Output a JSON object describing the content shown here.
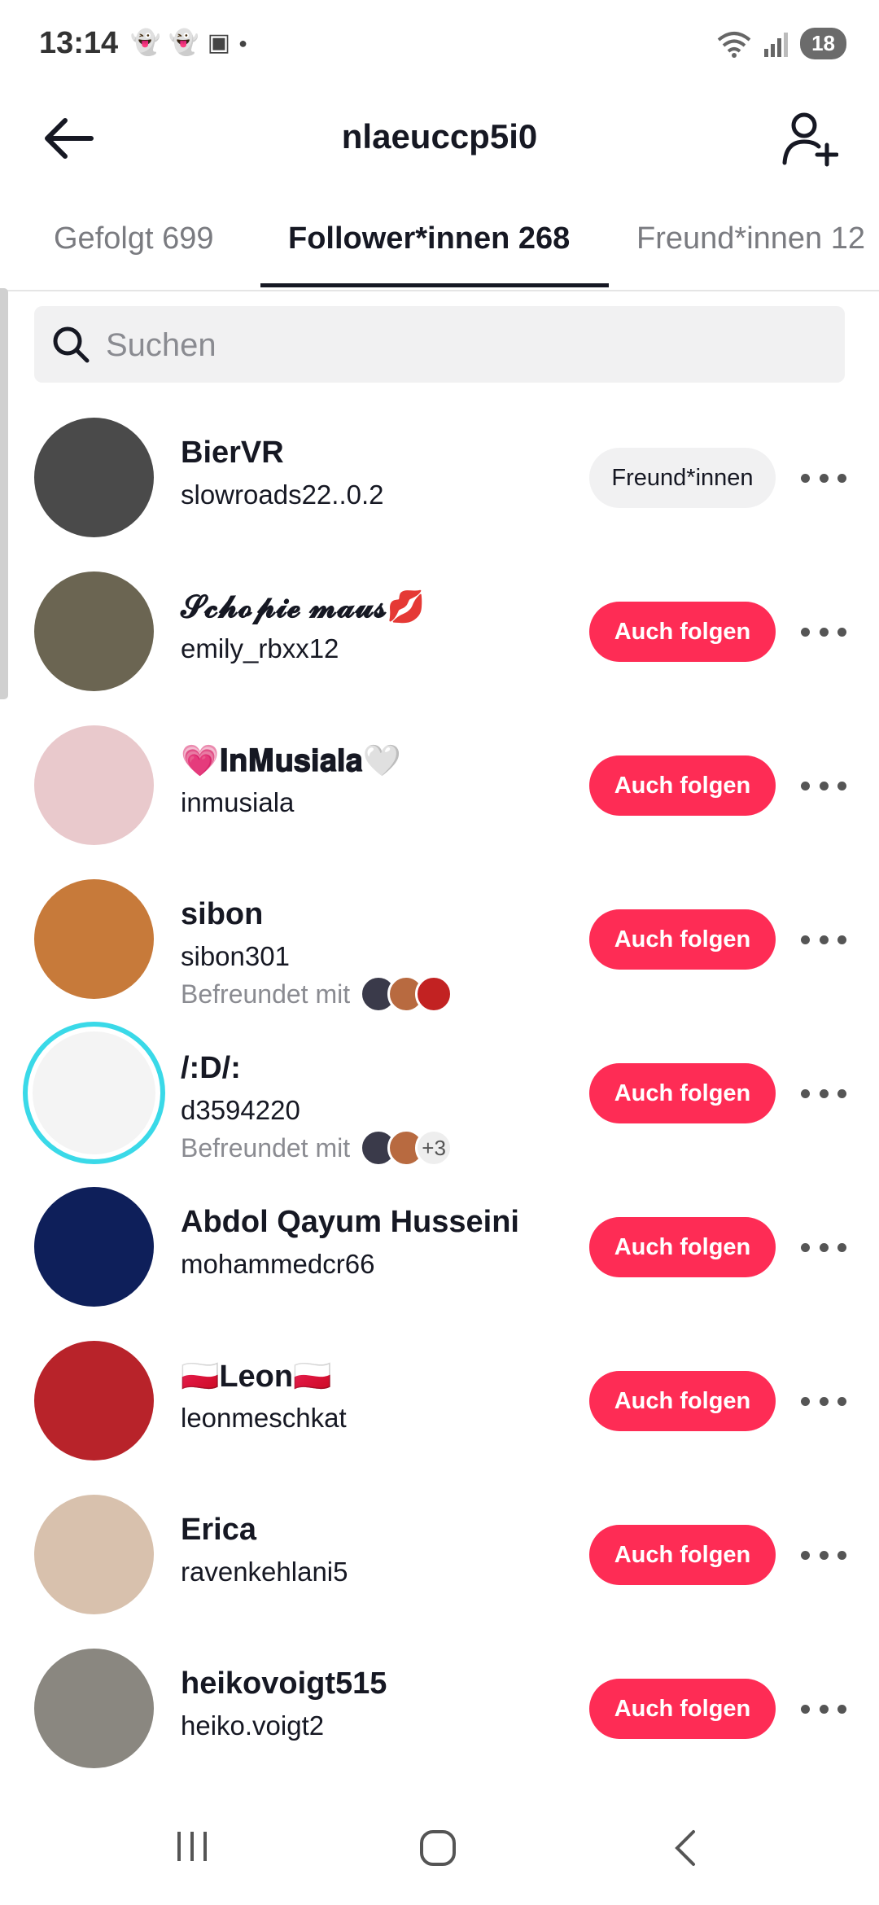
{
  "status_bar": {
    "time": "13:14",
    "notification_icons": [
      "snapchat-icon",
      "snapchat-icon",
      "twitch-icon",
      "dot-icon"
    ],
    "battery": "18"
  },
  "header": {
    "title": "nlaeuccp5i0",
    "back_icon": "arrow-left-icon",
    "add_user_icon": "add-user-icon"
  },
  "tabs": [
    {
      "label": "Gefolgt 699",
      "active": false
    },
    {
      "label": "Follower*innen 268",
      "active": true
    },
    {
      "label": "Freund*innen 12",
      "active": false
    }
  ],
  "search": {
    "placeholder": "Suchen",
    "value": ""
  },
  "users": [
    {
      "name": "BierVR",
      "handle": "slowroads22..0.2",
      "mutual": "",
      "button": "Freund*innen",
      "button_style": "friend",
      "avatar_color": "#4a4a4a"
    },
    {
      "name": "𝓢𝓬𝓱𝓸𝓹𝓲𝓮 𝓶𝓪𝓾𝓼💋",
      "handle": "emily_rbxx12",
      "mutual": "",
      "button": "Auch folgen",
      "button_style": "follow",
      "avatar_color": "#6b6552"
    },
    {
      "name": "💗𝐈𝐧𝐌𝐮𝐬𝐢𝐚𝐥𝐚🤍",
      "handle": "inmusiala",
      "mutual": "",
      "button": "Auch folgen",
      "button_style": "follow",
      "avatar_color": "#e9c9cc"
    },
    {
      "name": "sibon",
      "handle": "sibon301",
      "mutual": "Befreundet mit",
      "mutual_extra": "",
      "button": "Auch folgen",
      "button_style": "follow",
      "avatar_color": "#c77a3a"
    },
    {
      "name": "/:D/:",
      "handle": "d3594220",
      "mutual": "Befreundet mit",
      "mutual_extra": "+3",
      "button": "Auch folgen",
      "button_style": "follow",
      "avatar_color": "#f4f4f4"
    },
    {
      "name": "Abdol Qayum Husseini",
      "handle": "mohammedcr66",
      "mutual": "",
      "button": "Auch folgen",
      "button_style": "follow",
      "avatar_color": "#0e1f5a"
    },
    {
      "name": "🇵🇱Leon🇵🇱",
      "handle": "leonmeschkat",
      "mutual": "",
      "button": "Auch folgen",
      "button_style": "follow",
      "avatar_color": "#b8232a"
    },
    {
      "name": "Erica",
      "handle": "ravenkehlani5",
      "mutual": "",
      "button": "Auch folgen",
      "button_style": "follow",
      "avatar_color": "#d8c1ad"
    },
    {
      "name": "heikovoigt515",
      "handle": "heiko.voigt2",
      "mutual": "",
      "button": "Auch folgen",
      "button_style": "follow",
      "avatar_color": "#8a8780"
    }
  ],
  "colors": {
    "accent": "#fe2c55",
    "ring": "#3ad9e8",
    "text": "#161823",
    "muted": "#8a8b91"
  }
}
